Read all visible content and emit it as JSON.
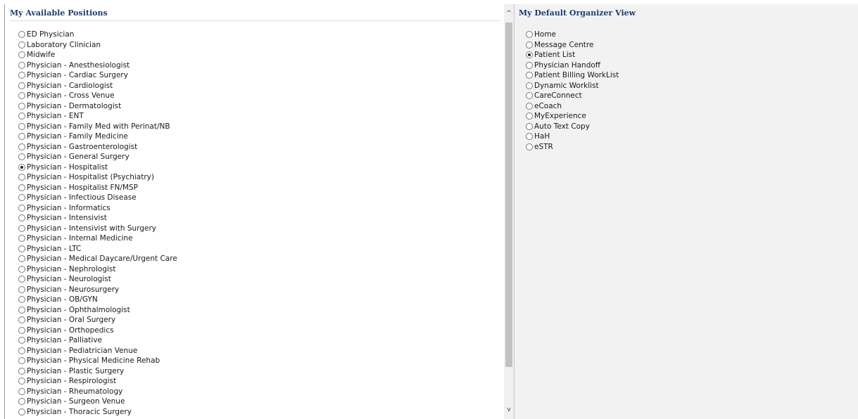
{
  "positions": {
    "title": "My Available Positions",
    "items": [
      {
        "label": "ED Physician",
        "checked": false
      },
      {
        "label": "Laboratory Clinician",
        "checked": false
      },
      {
        "label": "Midwife",
        "checked": false
      },
      {
        "label": "Physician - Anesthesiologist",
        "checked": false
      },
      {
        "label": "Physician - Cardiac Surgery",
        "checked": false
      },
      {
        "label": "Physician - Cardiologist",
        "checked": false
      },
      {
        "label": "Physician - Cross Venue",
        "checked": false
      },
      {
        "label": "Physician - Dermatologist",
        "checked": false
      },
      {
        "label": "Physician - ENT",
        "checked": false
      },
      {
        "label": "Physician - Family Med with Perinat/NB",
        "checked": false
      },
      {
        "label": "Physician - Family Medicine",
        "checked": false
      },
      {
        "label": "Physician - Gastroenterologist",
        "checked": false
      },
      {
        "label": "Physician - General Surgery",
        "checked": false
      },
      {
        "label": "Physician - Hospitalist",
        "checked": true
      },
      {
        "label": "Physician - Hospitalist (Psychiatry)",
        "checked": false
      },
      {
        "label": "Physician - Hospitalist FN/MSP",
        "checked": false
      },
      {
        "label": "Physician - Infectious Disease",
        "checked": false
      },
      {
        "label": "Physician - Informatics",
        "checked": false
      },
      {
        "label": "Physician - Intensivist",
        "checked": false
      },
      {
        "label": "Physician - Intensivist with Surgery",
        "checked": false
      },
      {
        "label": "Physician - Internal Medicine",
        "checked": false
      },
      {
        "label": "Physician - LTC",
        "checked": false
      },
      {
        "label": "Physician - Medical Daycare/Urgent Care",
        "checked": false
      },
      {
        "label": "Physician - Nephrologist",
        "checked": false
      },
      {
        "label": "Physician - Neurologist",
        "checked": false
      },
      {
        "label": "Physician - Neurosurgery",
        "checked": false
      },
      {
        "label": "Physician - OB/GYN",
        "checked": false
      },
      {
        "label": "Physician - Ophthalmologist",
        "checked": false
      },
      {
        "label": "Physician - Oral Surgery",
        "checked": false
      },
      {
        "label": "Physician - Orthopedics",
        "checked": false
      },
      {
        "label": "Physician - Palliative",
        "checked": false
      },
      {
        "label": "Physician - Pediatrician Venue",
        "checked": false
      },
      {
        "label": "Physician - Physical Medicine Rehab",
        "checked": false
      },
      {
        "label": "Physician - Plastic Surgery",
        "checked": false
      },
      {
        "label": "Physician - Respirologist",
        "checked": false
      },
      {
        "label": "Physician - Rheumatology",
        "checked": false
      },
      {
        "label": "Physician - Surgeon Venue",
        "checked": false
      },
      {
        "label": "Physician - Thoracic Surgery",
        "checked": false
      }
    ]
  },
  "scrollbar": {
    "up_icon": "chevron-up-icon",
    "down_icon": "chevron-down-icon",
    "up_glyph": "^",
    "down_glyph": "v"
  },
  "organizer": {
    "title": "My Default Organizer View",
    "items": [
      {
        "label": "Home",
        "checked": false
      },
      {
        "label": "Message Centre",
        "checked": false
      },
      {
        "label": "Patient List",
        "checked": true
      },
      {
        "label": "Physician Handoff",
        "checked": false
      },
      {
        "label": "Patient Billing WorkList",
        "checked": false
      },
      {
        "label": "Dynamic Worklist",
        "checked": false
      },
      {
        "label": "CareConnect",
        "checked": false
      },
      {
        "label": "eCoach",
        "checked": false
      },
      {
        "label": "MyExperience",
        "checked": false
      },
      {
        "label": "Auto Text Copy",
        "checked": false
      },
      {
        "label": "HaH",
        "checked": false
      },
      {
        "label": "eSTR",
        "checked": false
      }
    ]
  },
  "colors": {
    "header_text": "#1f3c73",
    "right_panel_bg": "#f2f2f2",
    "scroll_thumb": "#c2c2c2"
  }
}
